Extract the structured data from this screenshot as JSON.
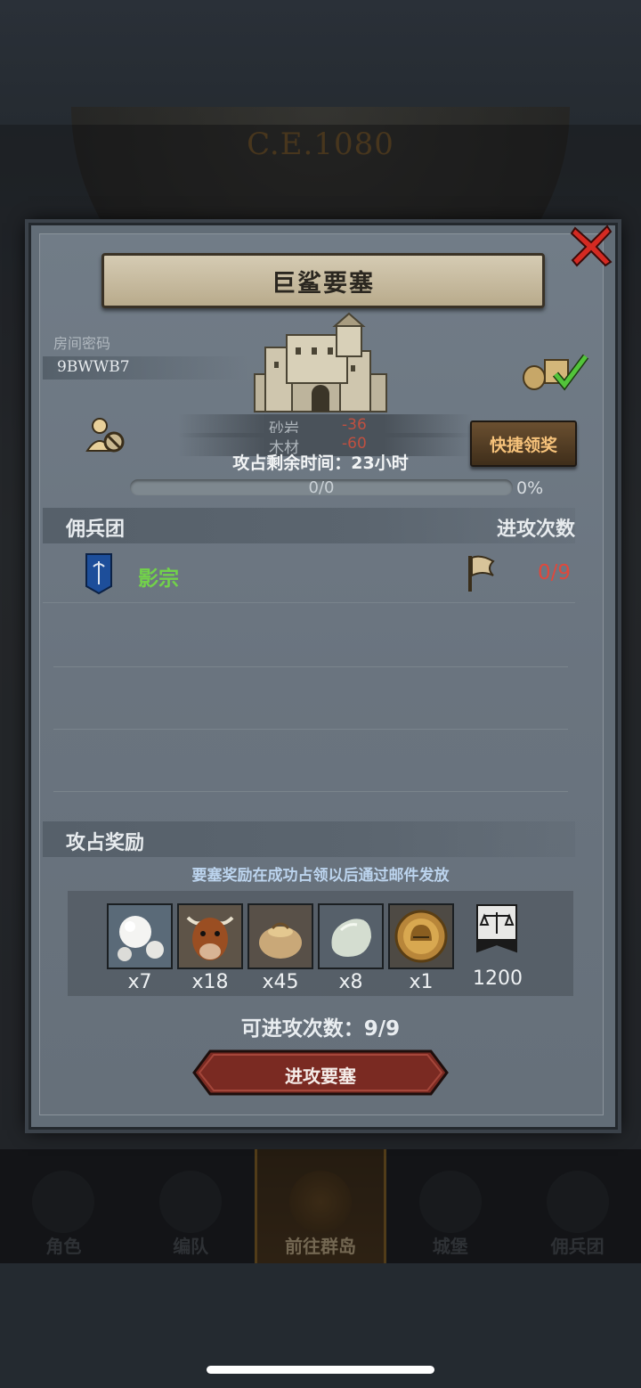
{
  "background": {
    "year_label": "C.E.1080"
  },
  "dialog": {
    "title": "巨鲨要塞",
    "room_label": "房间密码",
    "room_code": "9BWWB7",
    "resources": [
      {
        "name": "砂岩",
        "value": "-36"
      },
      {
        "name": "木材",
        "value": "-60"
      }
    ],
    "quick_claim_label": "快捷领奖",
    "time_text": "攻占剩余时间：23小时",
    "progress": {
      "text": "0/0",
      "percent_label": "0%",
      "value": 0
    },
    "mercenary_section": {
      "title": "佣兵团",
      "attacks_title": "进攻次数"
    },
    "guilds": [
      {
        "name": "影宗",
        "attacks": "0/9"
      }
    ],
    "reward_section": {
      "title": "攻占奖励",
      "note": "要塞奖励在成功占领以后通过邮件发放"
    },
    "rewards": [
      {
        "icon": "pearls-icon",
        "qty": "x7"
      },
      {
        "icon": "cattle-icon",
        "qty": "x18"
      },
      {
        "icon": "grain-sack-icon",
        "qty": "x45"
      },
      {
        "icon": "stone-icon",
        "qty": "x8"
      },
      {
        "icon": "gold-helmet-coin-icon",
        "qty": "x1"
      },
      {
        "icon": "justice-banner-icon",
        "qty": "1200"
      }
    ],
    "available_attacks": "可进攻次数：9/9",
    "attack_button_label": "进攻要塞"
  },
  "bottom_nav": [
    {
      "label": "角色",
      "active": false
    },
    {
      "label": "编队",
      "active": false
    },
    {
      "label": "前往群岛",
      "active": true
    },
    {
      "label": "城堡",
      "active": false
    },
    {
      "label": "佣兵团",
      "active": false
    }
  ],
  "colors": {
    "accent_gold": "#f6c27a",
    "guild_green": "#72d24a",
    "negative_red": "#e0483c",
    "note_blue": "#bcd4ee"
  }
}
